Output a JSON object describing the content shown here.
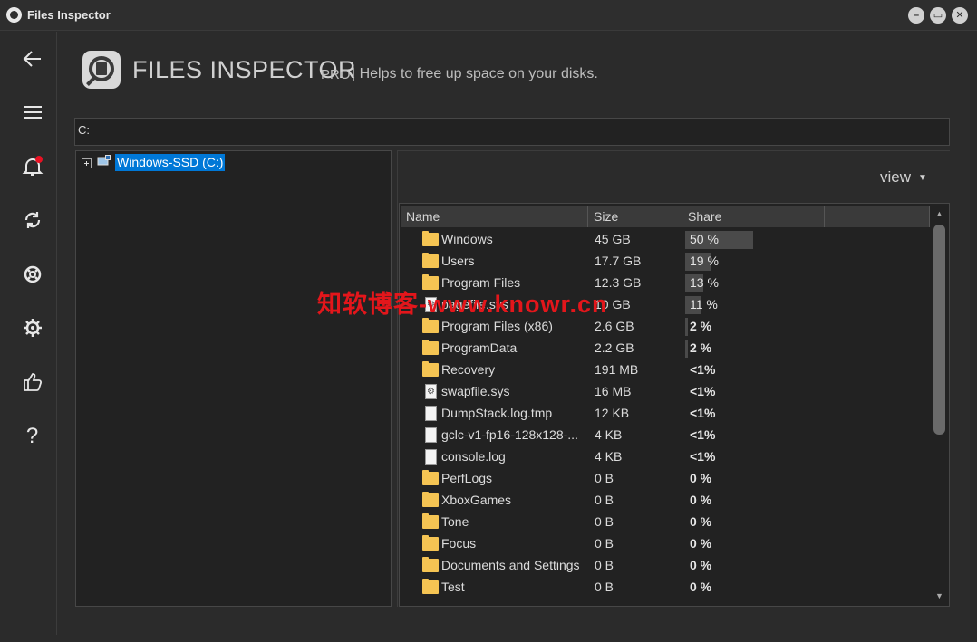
{
  "window": {
    "title": "Files Inspector",
    "controls": [
      "minimize-icon",
      "maximize-icon",
      "close-icon"
    ]
  },
  "rail": {
    "items": [
      {
        "name": "back",
        "icon": "arrow-left-icon"
      },
      {
        "name": "menu",
        "icon": "hamburger-icon"
      },
      {
        "name": "notifications",
        "icon": "bell-icon",
        "badge_color": "#e81123"
      },
      {
        "name": "refresh",
        "icon": "sync-icon"
      },
      {
        "name": "support",
        "icon": "lifebuoy-icon"
      },
      {
        "name": "settings",
        "icon": "gear-icon"
      },
      {
        "name": "rate",
        "icon": "thumbs-up-icon"
      },
      {
        "name": "help",
        "icon": "question-icon",
        "label": "?"
      }
    ]
  },
  "header": {
    "title": "FILES INSPECTOR",
    "edition": "PRO",
    "tagline": "| Helps to free up space on your disks."
  },
  "path": {
    "value": "C:"
  },
  "tree": {
    "nodes": [
      {
        "label": "Windows-SSD (C:)",
        "selected": true,
        "expanded": false
      }
    ]
  },
  "view_menu": {
    "label": "view",
    "caret": "▼"
  },
  "list": {
    "columns": [
      "Name",
      "Size",
      "Share"
    ],
    "rows": [
      {
        "type": "folder",
        "name": "Windows",
        "size": "45 GB",
        "share": "50 %",
        "share_fraction": 0.5
      },
      {
        "type": "folder",
        "name": "Users",
        "size": "17.7 GB",
        "share": "19 %",
        "share_fraction": 0.19
      },
      {
        "type": "folder",
        "name": "Program Files",
        "size": "12.3 GB",
        "share": "13 %",
        "share_fraction": 0.13
      },
      {
        "type": "sysfile",
        "name": "pagefile.sys",
        "size": "10 GB",
        "share": "11 %",
        "share_fraction": 0.11
      },
      {
        "type": "folder",
        "name": "Program Files (x86)",
        "size": "2.6 GB",
        "share": "2 %",
        "share_fraction": 0.02
      },
      {
        "type": "folder",
        "name": "ProgramData",
        "size": "2.2 GB",
        "share": "2 %",
        "share_fraction": 0.02
      },
      {
        "type": "folder",
        "name": "Recovery",
        "size": "191 MB",
        "share": "<1%",
        "share_fraction": 0
      },
      {
        "type": "sysfile",
        "name": "swapfile.sys",
        "size": "16 MB",
        "share": "<1%",
        "share_fraction": 0
      },
      {
        "type": "file",
        "name": "DumpStack.log.tmp",
        "size": "12 KB",
        "share": "<1%",
        "share_fraction": 0
      },
      {
        "type": "file",
        "name": "gclc-v1-fp16-128x128-...",
        "size": "4 KB",
        "share": "<1%",
        "share_fraction": 0
      },
      {
        "type": "file",
        "name": "console.log",
        "size": "4 KB",
        "share": "<1%",
        "share_fraction": 0
      },
      {
        "type": "folder",
        "name": "PerfLogs",
        "size": "0 B",
        "share": "0 %",
        "share_fraction": 0
      },
      {
        "type": "folder",
        "name": "XboxGames",
        "size": "0 B",
        "share": "0 %",
        "share_fraction": 0
      },
      {
        "type": "folder",
        "name": "Tone",
        "size": "0 B",
        "share": "0 %",
        "share_fraction": 0
      },
      {
        "type": "folder",
        "name": "Focus",
        "size": "0 B",
        "share": "0 %",
        "share_fraction": 0
      },
      {
        "type": "folder",
        "name": "Documents and Settings",
        "size": "0 B",
        "share": "0 %",
        "share_fraction": 0
      },
      {
        "type": "folder",
        "name": "Test",
        "size": "0 B",
        "share": "0 %",
        "share_fraction": 0
      }
    ]
  },
  "watermark": {
    "text": "知软博客-www.knowr.cn",
    "color": "#e3161b"
  }
}
